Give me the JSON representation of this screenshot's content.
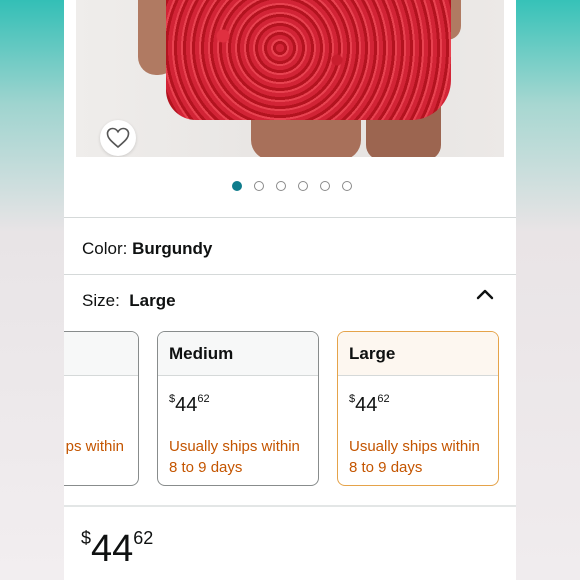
{
  "carousel": {
    "slide_count": 6,
    "active_index": 0
  },
  "color": {
    "label": "Color:",
    "value": "Burgundy"
  },
  "size": {
    "label": "Size:",
    "value": "Large",
    "options": [
      {
        "name": "",
        "price_symbol": "",
        "price_whole": "",
        "price_fraction": "",
        "shipping": "ps within",
        "shipping2": ""
      },
      {
        "name": "Medium",
        "price_symbol": "$",
        "price_whole": "44",
        "price_fraction": "62",
        "shipping": "Usually ships within",
        "shipping2": "8 to 9 days"
      },
      {
        "name": "Large",
        "price_symbol": "$",
        "price_whole": "44",
        "price_fraction": "62",
        "shipping": "Usually ships within",
        "shipping2": "8 to 9 days"
      }
    ]
  },
  "price": {
    "symbol": "$",
    "whole": "44",
    "fraction": "62"
  },
  "colors": {
    "accent": "#0f7c8c",
    "selected_border": "#e5a34a",
    "shipping_text": "#c45500"
  }
}
